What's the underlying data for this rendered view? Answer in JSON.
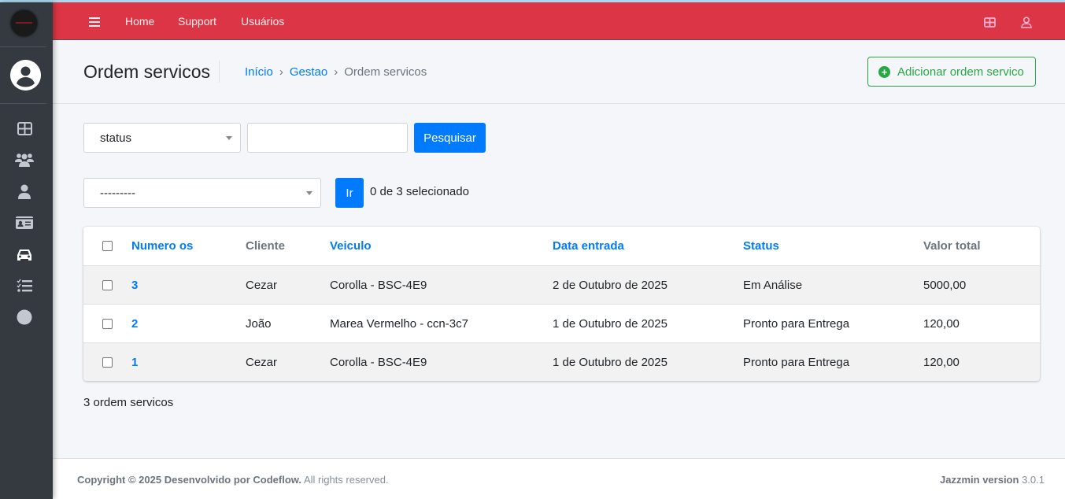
{
  "navbar": {
    "home": "Home",
    "support": "Support",
    "users": "Usuários",
    "color": "#dc3545"
  },
  "header": {
    "title": "Ordem servicos",
    "breadcrumb": [
      "Início",
      "Gestao",
      "Ordem servicos"
    ],
    "add_button": "Adicionar ordem servico"
  },
  "filters": {
    "status_select": "status",
    "search_value": "",
    "search_button": "Pesquisar"
  },
  "actions": {
    "action_select": "---------",
    "go_button": "Ir",
    "selection_count": "0 de 3 selecionado"
  },
  "table": {
    "columns": [
      "Numero os",
      "Cliente",
      "Veiculo",
      "Data entrada",
      "Status",
      "Valor total"
    ],
    "rows": [
      {
        "numero": "3",
        "cliente": "Cezar",
        "veiculo": "Corolla - BSC-4E9",
        "data": "2 de Outubro de 2025",
        "status": "Em Análise",
        "valor": "5000,00"
      },
      {
        "numero": "2",
        "cliente": "João",
        "veiculo": "Marea Vermelho - ccn-3c7",
        "data": "1 de Outubro de 2025",
        "status": "Pronto para Entrega",
        "valor": "120,00"
      },
      {
        "numero": "1",
        "cliente": "Cezar",
        "veiculo": "Corolla - BSC-4E9",
        "data": "1 de Outubro de 2025",
        "status": "Pronto para Entrega",
        "valor": "120,00"
      }
    ]
  },
  "result_count": "3 ordem servicos",
  "footer": {
    "copyright": "Copyright © 2025 Desenvolvido por Codeflow.",
    "rights": "All rights reserved.",
    "version_label": "Jazzmin version",
    "version": "3.0.1"
  },
  "sidebar": {
    "icons": [
      "dashboard-icon",
      "users-icon",
      "user-icon",
      "id-card-icon",
      "car-icon",
      "tasks-icon",
      "circle-icon"
    ]
  }
}
